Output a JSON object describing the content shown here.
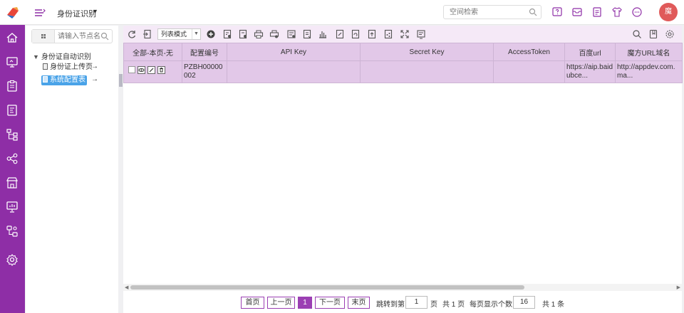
{
  "header": {
    "app_title": "身份证识别",
    "search_placeholder": "空间检索",
    "avatar_text": "魔",
    "icons": [
      "help-icon",
      "inbox-icon",
      "document-icon",
      "shirt-icon",
      "chat-icon"
    ]
  },
  "sidebar": {
    "accent": "#8e2ea6",
    "items": [
      "home-icon",
      "monitor-icon",
      "clipboard-icon",
      "form-icon",
      "hierarchy-icon",
      "share-icon",
      "store-icon",
      "presentation-icon",
      "workflow-icon",
      "settings-icon"
    ]
  },
  "tree": {
    "search_placeholder": "请输入节点名",
    "root_label": "身份证自动识别",
    "nodes": [
      {
        "label": "身份证上传页"
      },
      {
        "label": "系统配置表"
      }
    ]
  },
  "toolbar": {
    "mode_label": "列表模式"
  },
  "table": {
    "columns": [
      "全部-本页-无",
      "配置编号",
      "API Key",
      "Secret Key",
      "AccessToken",
      "百度url",
      "魔方URL域名"
    ],
    "rows": [
      {
        "id": "PZBH00000002",
        "api_key": "",
        "secret_key": "",
        "access_token": "",
        "baidu_url": "https://aip.baidubce...",
        "mofang_url": "http://appdev.com.ma..."
      }
    ]
  },
  "pager": {
    "first": "首页",
    "prev": "上一页",
    "current_page": "1",
    "next": "下一页",
    "last": "末页",
    "jump_label": "跳转到第",
    "jump_value": "1",
    "page_unit": "页",
    "total_pages": "共 1 页",
    "page_size_label": "每页显示个数:",
    "page_size": "16",
    "total_records": "共 1 条"
  }
}
